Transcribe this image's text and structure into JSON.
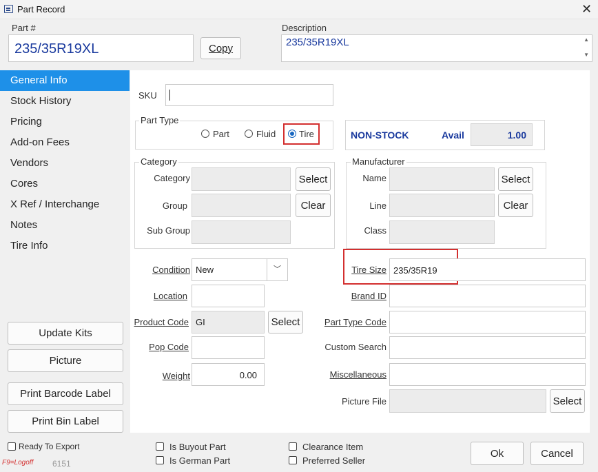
{
  "window": {
    "title": "Part Record",
    "close": "✕"
  },
  "header": {
    "part_label": "Part #",
    "part_value": "235/35R19XL",
    "copy_button": "Copy",
    "description_label": "Description",
    "description_value": "235/35R19XL"
  },
  "sidebar": {
    "items": [
      {
        "label": "General Info"
      },
      {
        "label": "Stock History"
      },
      {
        "label": "Pricing"
      },
      {
        "label": "Add-on Fees"
      },
      {
        "label": "Vendors"
      },
      {
        "label": "Cores"
      },
      {
        "label": "X Ref / Interchange"
      },
      {
        "label": "Notes"
      },
      {
        "label": "Tire Info"
      }
    ],
    "buttons": [
      "Update Kits",
      "Picture",
      "Print Barcode Label",
      "Print Bin Label"
    ]
  },
  "general": {
    "sku_label": "SKU",
    "sku_value": "",
    "part_type_title": "Part Type",
    "part_type_options": [
      "Part",
      "Fluid",
      "Tire"
    ],
    "stock_status": "NON-STOCK",
    "avail_label": "Avail",
    "avail_value": "1.00",
    "category": {
      "title": "Category",
      "category_label": "Category",
      "group_label": "Group",
      "subgroup_label": "Sub Group",
      "select": "Select",
      "clear": "Clear"
    },
    "manufacturer": {
      "title": "Manufacturer",
      "name_label": "Name",
      "line_label": "Line",
      "class_label": "Class",
      "select": "Select",
      "clear": "Clear"
    },
    "condition_label": "Condition",
    "condition_value": "New",
    "location_label": "Location",
    "product_code_label": "Product Code",
    "product_code_value": "GI",
    "product_code_select": "Select",
    "pop_code_label": "Pop Code",
    "weight_label": "Weight",
    "weight_value": "0.00",
    "tire_size_label": "Tire Size",
    "tire_size_value": "235/35R19",
    "brand_id_label": "Brand ID",
    "part_type_code_label": "Part Type Code",
    "custom_search_label": "Custom Search",
    "misc_label": "Miscellaneous",
    "picture_file_label": "Picture File",
    "picture_select": "Select"
  },
  "footer": {
    "ready_to_export": "Ready To Export",
    "is_buyout": "Is Buyout Part",
    "is_german": "Is German Part",
    "clearance": "Clearance Item",
    "preferred_seller": "Preferred Seller",
    "f9": "F9=Logoff",
    "code": "6151",
    "ok": "Ok",
    "cancel": "Cancel"
  },
  "colors": {
    "accent": "#1e90e8",
    "highlight": "#d32f2f",
    "navy": "#1a3a9e"
  }
}
